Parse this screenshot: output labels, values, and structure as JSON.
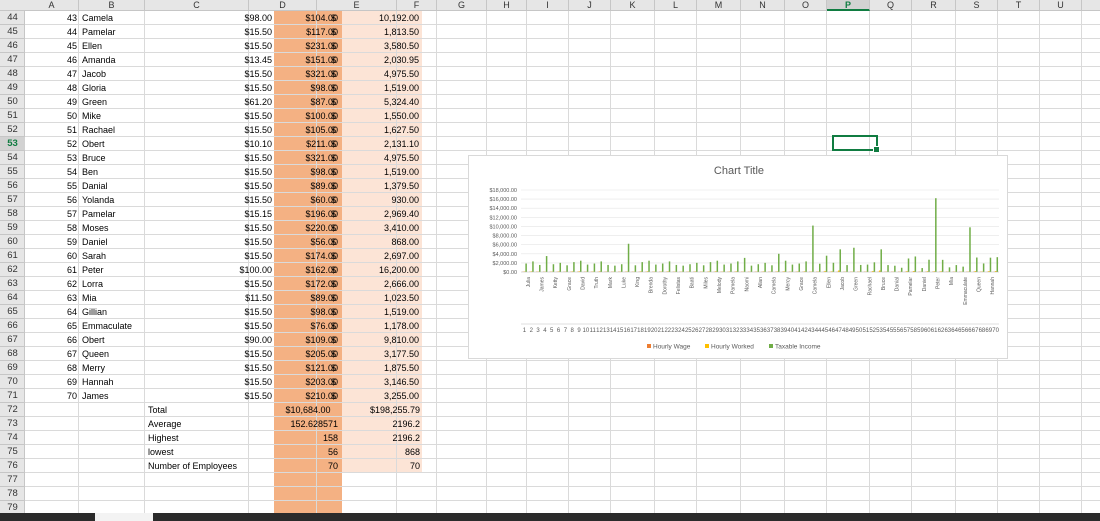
{
  "columns": [
    "A",
    "B",
    "C",
    "D",
    "E",
    "F",
    "G",
    "H",
    "I",
    "J",
    "K",
    "L",
    "M",
    "N",
    "O",
    "P",
    "Q",
    "R",
    "S",
    "T",
    "U"
  ],
  "selected_column": "P",
  "rows": [
    44,
    45,
    46,
    47,
    48,
    49,
    50,
    51,
    52,
    53,
    54,
    55,
    56,
    57,
    58,
    59,
    60,
    61,
    62,
    63,
    64,
    65,
    66,
    67,
    68,
    69,
    70,
    71,
    72,
    73,
    74,
    75,
    76,
    77,
    78,
    79
  ],
  "selected_row": 53,
  "records": [
    {
      "num": "43",
      "name": "Camela",
      "wage": "$98.00",
      "hours": "$104.00",
      "income": "10,192.00"
    },
    {
      "num": "44",
      "name": "Pamelar",
      "wage": "$15.50",
      "hours": "$117.00",
      "income": "1,813.50"
    },
    {
      "num": "45",
      "name": "Ellen",
      "wage": "$15.50",
      "hours": "$231.00",
      "income": "3,580.50"
    },
    {
      "num": "46",
      "name": "Amanda",
      "wage": "$13.45",
      "hours": "$151.00",
      "income": "2,030.95"
    },
    {
      "num": "47",
      "name": "Jacob",
      "wage": "$15.50",
      "hours": "$321.00",
      "income": "4,975.50"
    },
    {
      "num": "48",
      "name": "Gloria",
      "wage": "$15.50",
      "hours": "$98.00",
      "income": "1,519.00"
    },
    {
      "num": "49",
      "name": "Green",
      "wage": "$61.20",
      "hours": "$87.00",
      "income": "5,324.40"
    },
    {
      "num": "50",
      "name": "Mike",
      "wage": "$15.50",
      "hours": "$100.00",
      "income": "1,550.00"
    },
    {
      "num": "51",
      "name": "Rachael",
      "wage": "$15.50",
      "hours": "$105.00",
      "income": "1,627.50"
    },
    {
      "num": "52",
      "name": "Obert",
      "wage": "$10.10",
      "hours": "$211.00",
      "income": "2,131.10"
    },
    {
      "num": "53",
      "name": "Bruce",
      "wage": "$15.50",
      "hours": "$321.00",
      "income": "4,975.50"
    },
    {
      "num": "54",
      "name": "Ben",
      "wage": "$15.50",
      "hours": "$98.00",
      "income": "1,519.00"
    },
    {
      "num": "55",
      "name": "Danial",
      "wage": "$15.50",
      "hours": "$89.00",
      "income": "1,379.50"
    },
    {
      "num": "56",
      "name": "Yolanda",
      "wage": "$15.50",
      "hours": "$60.00",
      "income": "930.00"
    },
    {
      "num": "57",
      "name": "Pamelar",
      "wage": "$15.15",
      "hours": "$196.00",
      "income": "2,969.40"
    },
    {
      "num": "58",
      "name": "Moses",
      "wage": "$15.50",
      "hours": "$220.00",
      "income": "3,410.00"
    },
    {
      "num": "59",
      "name": "Daniel",
      "wage": "$15.50",
      "hours": "$56.00",
      "income": "868.00"
    },
    {
      "num": "60",
      "name": "Sarah",
      "wage": "$15.50",
      "hours": "$174.00",
      "income": "2,697.00"
    },
    {
      "num": "61",
      "name": "Peter",
      "wage": "$100.00",
      "hours": "$162.00",
      "income": "16,200.00"
    },
    {
      "num": "62",
      "name": "Lorra",
      "wage": "$15.50",
      "hours": "$172.00",
      "income": "2,666.00"
    },
    {
      "num": "63",
      "name": "Mia",
      "wage": "$11.50",
      "hours": "$89.00",
      "income": "1,023.50"
    },
    {
      "num": "64",
      "name": "Gillian",
      "wage": "$15.50",
      "hours": "$98.00",
      "income": "1,519.00"
    },
    {
      "num": "65",
      "name": "Emmaculate",
      "wage": "$15.50",
      "hours": "$76.00",
      "income": "1,178.00"
    },
    {
      "num": "66",
      "name": "Obert",
      "wage": "$90.00",
      "hours": "$109.00",
      "income": "9,810.00"
    },
    {
      "num": "67",
      "name": "Queen",
      "wage": "$15.50",
      "hours": "$205.00",
      "income": "3,177.50"
    },
    {
      "num": "68",
      "name": "Merry",
      "wage": "$15.50",
      "hours": "$121.00",
      "income": "1,875.50"
    },
    {
      "num": "69",
      "name": "Hannah",
      "wage": "$15.50",
      "hours": "$203.00",
      "income": "3,146.50"
    },
    {
      "num": "70",
      "name": "James",
      "wage": "$15.50",
      "hours": "$210.00",
      "income": "3,255.00"
    }
  ],
  "dollar_sign": "$",
  "summary": [
    {
      "label": "Total",
      "d": "$10,684.00",
      "e": "$198,255.79"
    },
    {
      "label": "Average",
      "d": "152.628571",
      "e": "2196.2"
    },
    {
      "label": "Highest",
      "d": "158",
      "e": "2196.2"
    },
    {
      "label": "lowest",
      "d": "56",
      "e": "868"
    },
    {
      "label": "Number of Employees",
      "d": "70",
      "e": "70"
    }
  ],
  "colors": {
    "accent": "#107c41",
    "fill_d": "#f4b183",
    "fill_e": "#fce4d6",
    "hourly_wage": "#ed7d31",
    "hourly_worked": "#ffc000",
    "taxable_income": "#70ad47"
  },
  "chart_data": {
    "type": "bar",
    "title": "Chart Title",
    "legend_position": "bottom",
    "grid": true,
    "ylim": [
      0,
      18000
    ],
    "y_ticks": [
      "$18,000.00",
      "$16,000.00",
      "$14,000.00",
      "$12,000.00",
      "$10,000.00",
      "$8,000.00",
      "$6,000.00",
      "$4,000.00",
      "$2,000.00",
      "$0.00"
    ],
    "names": [
      "Julia",
      "James",
      "Ketty",
      "Grace",
      "David",
      "Truth",
      "Mark",
      "Luke",
      "King",
      "Brenda",
      "Dorothy",
      "Felistas",
      "Baati",
      "Miles",
      "Melody",
      "Pamela",
      "Naomi",
      "Allan",
      "Camela",
      "Mercy",
      "Grace",
      "Camela",
      "Ellen",
      "Jacob",
      "Green",
      "Rachael",
      "Bruce",
      "Danial",
      "Pamelar",
      "Daniel",
      "Peter",
      "Mia",
      "Emmaculate",
      "Queen",
      "Hannah"
    ],
    "categories": [
      "1",
      "2",
      "3",
      "4",
      "5",
      "6",
      "7",
      "8",
      "9",
      "10",
      "11",
      "12",
      "13",
      "14",
      "15",
      "16",
      "17",
      "18",
      "19",
      "20",
      "21",
      "22",
      "23",
      "24",
      "25",
      "26",
      "27",
      "28",
      "29",
      "30",
      "31",
      "32",
      "33",
      "34",
      "35",
      "36",
      "37",
      "38",
      "39",
      "40",
      "41",
      "42",
      "43",
      "44",
      "45",
      "46",
      "47",
      "48",
      "49",
      "50",
      "51",
      "52",
      "53",
      "54",
      "55",
      "56",
      "57",
      "58",
      "59",
      "60",
      "61",
      "62",
      "63",
      "64",
      "65",
      "66",
      "67",
      "68",
      "69",
      "70"
    ],
    "series": [
      {
        "name": "Hourly Wage",
        "values": [
          15.5,
          15.5,
          15.5,
          20,
          15.5,
          15.5,
          15.5,
          15.5,
          15.5,
          15.5,
          15.5,
          15.5,
          15.5,
          15.5,
          15.5,
          15.5,
          15.5,
          15.5,
          15.5,
          15.5,
          15.5,
          15.5,
          15.5,
          15.5,
          15.5,
          15.5,
          15.5,
          15.5,
          15.5,
          15.5,
          15.5,
          15.5,
          15.5,
          15.5,
          15.5,
          15.5,
          15.5,
          15.5,
          15.5,
          15.5,
          15.5,
          15.5,
          98,
          15.5,
          15.5,
          13.45,
          15.5,
          15.5,
          61.2,
          15.5,
          15.5,
          10.1,
          15.5,
          15.5,
          15.5,
          15.5,
          15.15,
          15.5,
          15.5,
          15.5,
          100,
          15.5,
          11.5,
          15.5,
          15.5,
          90,
          15.5,
          15.5,
          15.5,
          15.5
        ]
      },
      {
        "name": "Hourly Worked",
        "values": [
          120,
          150,
          100,
          90,
          110,
          130,
          95,
          140,
          160,
          105,
          120,
          150,
          100,
          90,
          110,
          130,
          95,
          140,
          160,
          105,
          120,
          150,
          100,
          90,
          110,
          130,
          95,
          140,
          160,
          105,
          120,
          150,
          100,
          90,
          110,
          130,
          95,
          140,
          160,
          105,
          120,
          150,
          104,
          117,
          231,
          151,
          321,
          98,
          87,
          100,
          105,
          211,
          321,
          98,
          89,
          60,
          196,
          220,
          56,
          174,
          162,
          172,
          89,
          98,
          76,
          109,
          205,
          121,
          203,
          210
        ]
      },
      {
        "name": "Taxable Income",
        "values": [
          1860,
          2325,
          1550,
          3500,
          1705,
          2015,
          1472,
          2170,
          2480,
          1627,
          1860,
          2325,
          1550,
          1395,
          1705,
          6200,
          1472,
          2170,
          2480,
          1627,
          1860,
          2325,
          1550,
          1395,
          1705,
          2015,
          1472,
          2170,
          2480,
          1627,
          1860,
          2325,
          3100,
          1395,
          1705,
          2015,
          1472,
          4000,
          2480,
          1627,
          1860,
          2325,
          10192,
          1813.5,
          3580.5,
          2030.95,
          4975.5,
          1519,
          5324.4,
          1550,
          1627.5,
          2131.1,
          4975.5,
          1519,
          1379.5,
          930,
          2969.4,
          3410,
          868,
          2697,
          16200,
          2666,
          1023.5,
          1519,
          1178,
          9810,
          3177.5,
          1875.5,
          3146.5,
          3255
        ]
      }
    ]
  }
}
